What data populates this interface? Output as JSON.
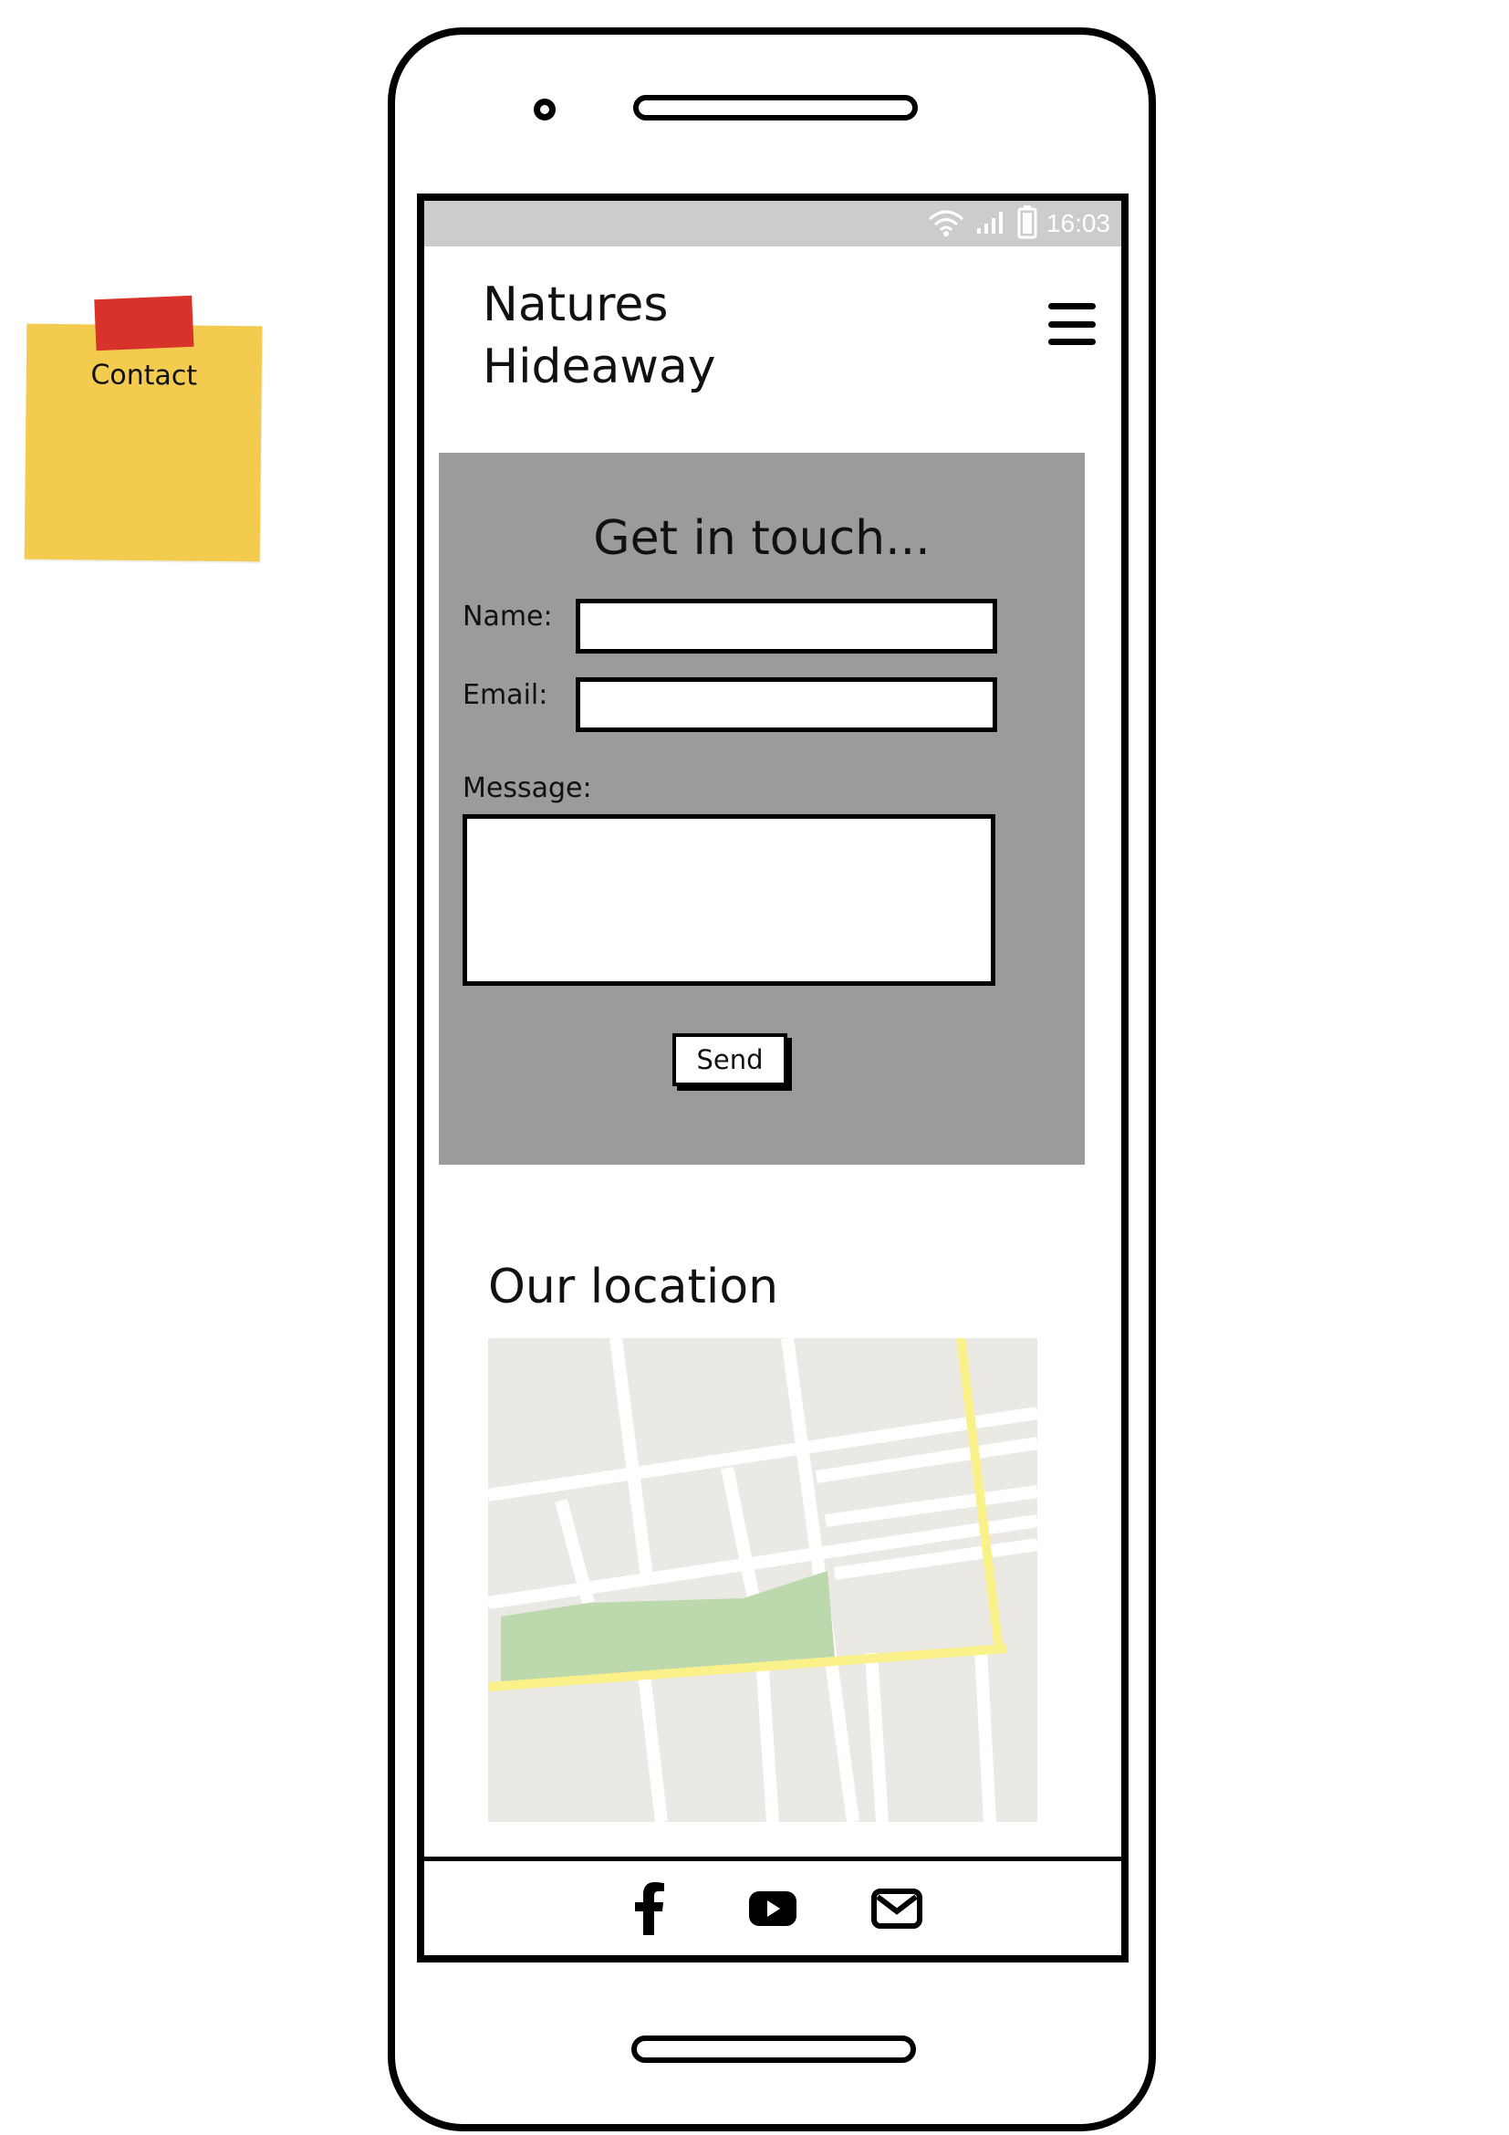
{
  "sticky_note": {
    "label": "Contact"
  },
  "status_bar": {
    "time": "16:03",
    "icons": [
      "wifi-icon",
      "signal-icon",
      "battery-icon"
    ]
  },
  "header": {
    "brand_line1": "Natures",
    "brand_line2": "Hideaway",
    "menu_icon": "hamburger-menu-icon"
  },
  "contact_form": {
    "title": "Get in touch...",
    "name_label": "Name:",
    "name_value": "",
    "email_label": "Email:",
    "email_value": "",
    "message_label": "Message:",
    "message_value": "",
    "send_label": "Send"
  },
  "location": {
    "title": "Our location"
  },
  "footer": {
    "icons": [
      "facebook-icon",
      "youtube-icon",
      "email-icon"
    ]
  },
  "colors": {
    "status_bar": "#cccccc",
    "form_background": "#9b9b9b",
    "sticky_note": "#f3cb4f",
    "tape": "#d9322a",
    "map_background": "#ebe9e4",
    "map_park": "#bcd8ad",
    "map_main_road": "#fbf18a"
  }
}
